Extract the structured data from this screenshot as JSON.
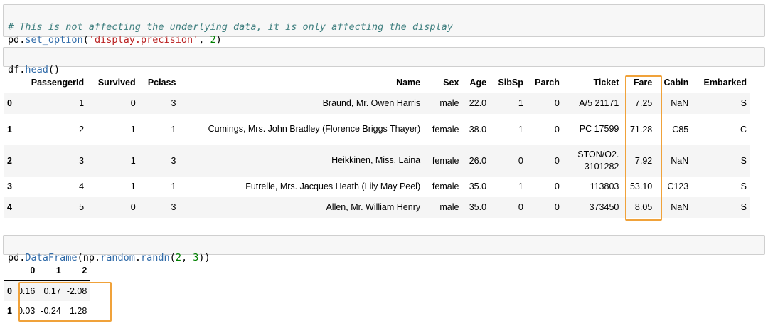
{
  "cells": {
    "precision": {
      "comment": "# This is not affecting the underlying data, it is only affecting the display",
      "obj": "pd",
      "dot": ".",
      "func": "set_option",
      "open": "(",
      "arg_str": "'display.precision'",
      "sep": ", ",
      "arg_num": "2",
      "close": ")"
    },
    "head": {
      "obj": "df",
      "dot": ".",
      "func": "head",
      "parens": "()"
    },
    "random": {
      "p1": "pd",
      "d1": ".",
      "f1": "DataFrame",
      "o1": "(",
      "p2": "np",
      "d2": ".",
      "f2": "random",
      "d3": ".",
      "f3": "randn",
      "o2": "(",
      "n1": "2",
      "s1": ", ",
      "n2": "3",
      "c1": "))"
    }
  },
  "titanic_table": {
    "columns": [
      "",
      "PassengerId",
      "Survived",
      "Pclass",
      "Name",
      "Sex",
      "Age",
      "SibSp",
      "Parch",
      "Ticket",
      "Fare",
      "Cabin",
      "Embarked"
    ],
    "rows": [
      [
        "0",
        "1",
        "0",
        "3",
        "Braund, Mr. Owen Harris",
        "male",
        "22.0",
        "1",
        "0",
        "A/5 21171",
        "7.25",
        "NaN",
        "S"
      ],
      [
        "1",
        "2",
        "1",
        "1",
        "Cumings, Mrs. John Bradley (Florence Briggs Thayer)",
        "female",
        "38.0",
        "1",
        "0",
        "PC 17599",
        "71.28",
        "C85",
        "C"
      ],
      [
        "2",
        "3",
        "1",
        "3",
        "Heikkinen, Miss. Laina",
        "female",
        "26.0",
        "0",
        "0",
        "STON/O2. 3101282",
        "7.92",
        "NaN",
        "S"
      ],
      [
        "3",
        "4",
        "1",
        "1",
        "Futrelle, Mrs. Jacques Heath (Lily May Peel)",
        "female",
        "35.0",
        "1",
        "0",
        "113803",
        "53.10",
        "C123",
        "S"
      ],
      [
        "4",
        "5",
        "0",
        "3",
        "Allen, Mr. William Henry",
        "male",
        "35.0",
        "0",
        "0",
        "373450",
        "8.05",
        "NaN",
        "S"
      ]
    ]
  },
  "random_table": {
    "columns": [
      "",
      "0",
      "1",
      "2"
    ],
    "rows": [
      [
        "0",
        "0.16",
        "0.17",
        "-2.08"
      ],
      [
        "1",
        "0.03",
        "-0.24",
        "1.28"
      ]
    ]
  },
  "colors": {
    "highlight": "#f0a23a",
    "cell_bg": "#f7f7f7"
  }
}
